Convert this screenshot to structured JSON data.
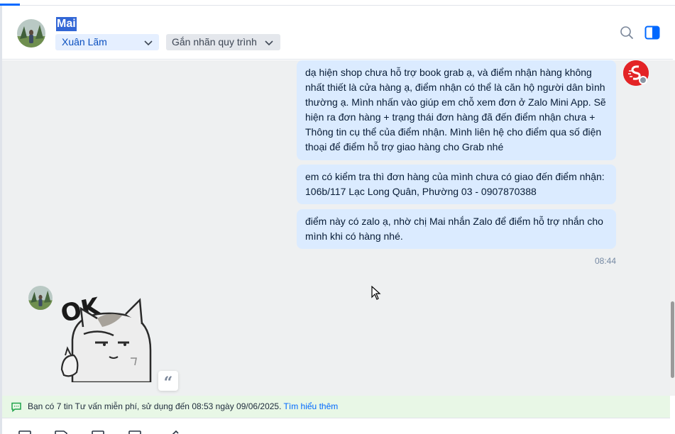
{
  "header": {
    "contact_name": "Mai",
    "assignee": "Xuân Lãm",
    "tag_placeholder": "Gắn nhãn quy trình"
  },
  "messages": {
    "outgoing": [
      "dạ hiện shop chưa hỗ trợ book grab ạ, và điểm nhận hàng không nhất thiết là cửa hàng ạ, điểm nhận có thể là căn hộ người dân bình thường ạ. Mình nhấn vào giúp em chỗ xem đơn ở Zalo Mini App. Sẽ hiện ra đơn hàng + trạng thái đơn hàng đã đến điểm nhận chưa + Thông tin cụ thể của điểm nhận. Mình liên hệ cho điểm qua số điện thoại để điểm hỗ trợ giao hàng cho Grab nhé",
      "em có kiểm tra thì đơn hàng của mình chưa có giao đến điểm nhận: 106b/117 Lạc Long Quân, Phường 03 - 0907870388",
      "điểm này có zalo ạ, nhờ chị Mai nhắn Zalo để điểm hỗ trợ nhắn cho mình khi có hàng nhé."
    ],
    "time": "08:44",
    "sticker_text": "OK"
  },
  "notice": {
    "text": "Bạn có 7 tin Tư vấn miễn phí, sử dụng đến 08:53 ngày 09/06/2025. ",
    "link": "Tìm hiểu thêm"
  },
  "icons": {
    "search": "search-icon",
    "panel": "toggle-panel-icon",
    "notice": "chat-bubble-icon"
  },
  "colors": {
    "accent": "#0068ff",
    "bubble": "#dbebff",
    "notice_bg": "#e8f7e6",
    "brand_red": "#e32426"
  }
}
